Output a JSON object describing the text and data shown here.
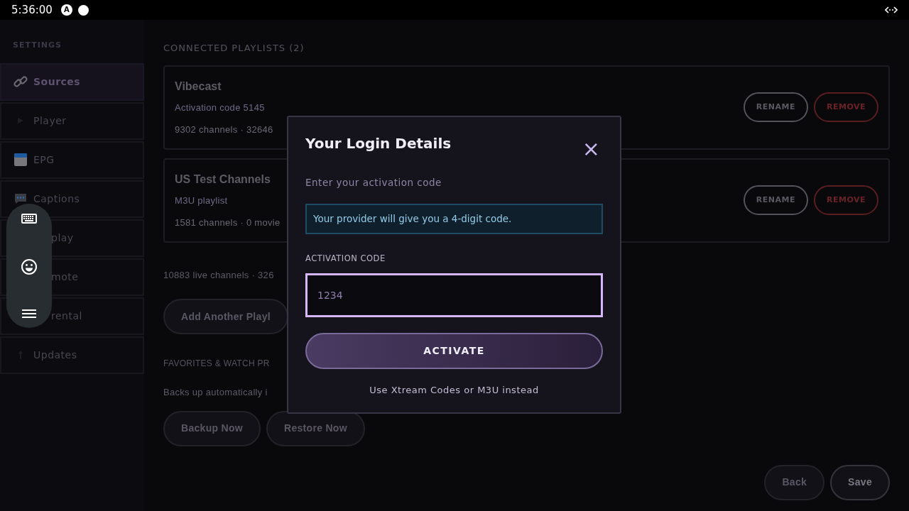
{
  "status_bar": {
    "time": "5:36:00",
    "badge": "A"
  },
  "sidebar": {
    "title": "SETTINGS",
    "items": [
      {
        "label": "Sources",
        "selected": true
      },
      {
        "label": "Player",
        "selected": false
      },
      {
        "label": "EPG",
        "selected": false
      },
      {
        "label": "Captions",
        "selected": false
      },
      {
        "label": "play",
        "selected": false
      },
      {
        "label": "mote",
        "selected": false
      },
      {
        "label": "rental",
        "selected": false
      },
      {
        "label": "Updates",
        "selected": false
      }
    ]
  },
  "main": {
    "heading": "CONNECTED PLAYLISTS (2)",
    "playlists": [
      {
        "name": "Vibecast",
        "subtitle": "Activation code 5145",
        "stats": "9302 channels · 32646",
        "rename": "RENAME",
        "remove": "REMOVE"
      },
      {
        "name": "US Test Channels",
        "subtitle": "M3U playlist",
        "stats": "1581 channels · 0 movie",
        "rename": "RENAME",
        "remove": "REMOVE"
      }
    ],
    "summary": "10883 live channels · 326",
    "add_button": "Add Another Playl",
    "favorites_heading": "FAVORITES & WATCH PR",
    "favorites_text": "Backs up automatically i",
    "backup_button": "Backup Now",
    "restore_button": "Restore Now",
    "back_button": "Back",
    "save_button": "Save"
  },
  "modal": {
    "title": "Your Login Details",
    "close": "×",
    "prompt": "Enter your activation code",
    "info": "Your provider will give you a 4-digit code.",
    "field_label": "ACTIVATION CODE",
    "placeholder": "1234",
    "activate_button": "ACTIVATE",
    "alt_link": "Use Xtream Codes or M3U instead"
  }
}
